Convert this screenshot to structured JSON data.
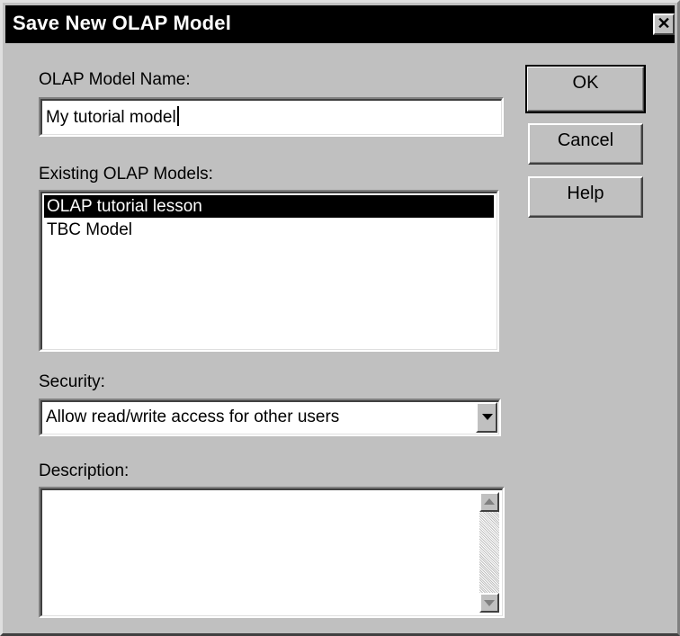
{
  "window": {
    "title": "Save New OLAP Model",
    "close_glyph": "✕"
  },
  "form": {
    "model_name_label": "OLAP Model Name:",
    "model_name_value": "My tutorial model",
    "existing_label": "Existing OLAP Models:",
    "existing_models": [
      "OLAP tutorial lesson",
      "TBC Model"
    ],
    "existing_selected_index": 0,
    "security_label": "Security:",
    "security_value": "Allow read/write access for other users",
    "description_label": "Description:",
    "description_value": ""
  },
  "buttons": {
    "ok": "OK",
    "cancel": "Cancel",
    "help": "Help"
  },
  "colors": {
    "dialog_bg": "#c0c0c0",
    "titlebar_bg": "#000000",
    "selection_bg": "#000000"
  }
}
